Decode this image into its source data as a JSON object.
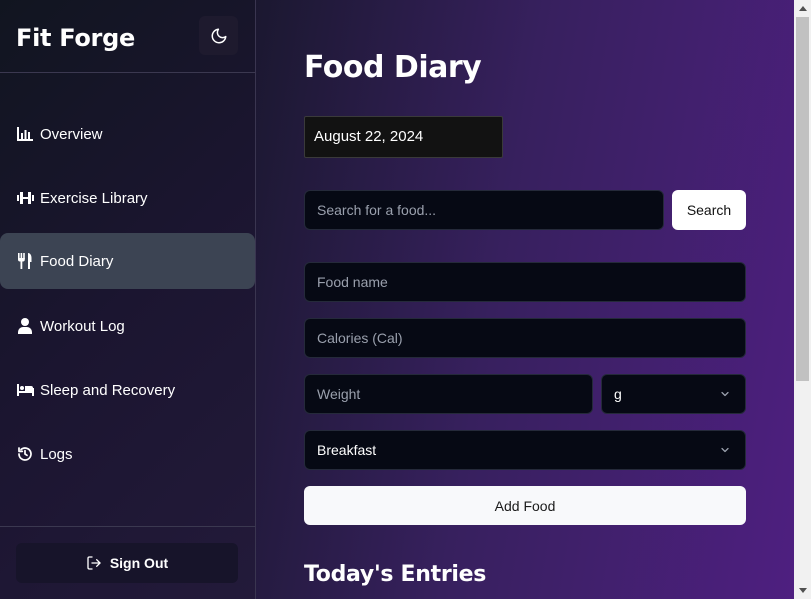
{
  "app": {
    "name": "Fit Forge"
  },
  "sidebar": {
    "theme_icon": "moon-icon",
    "items": [
      {
        "label": "Overview",
        "icon": "chart-bar-icon",
        "active": false
      },
      {
        "label": "Exercise Library",
        "icon": "dumbbell-icon",
        "active": false
      },
      {
        "label": "Food Diary",
        "icon": "utensils-icon",
        "active": true
      },
      {
        "label": "Workout Log",
        "icon": "user-icon",
        "active": false
      },
      {
        "label": "Sleep and Recovery",
        "icon": "bed-icon",
        "active": false
      },
      {
        "label": "Logs",
        "icon": "history-icon",
        "active": false
      }
    ],
    "sign_out": {
      "label": "Sign Out",
      "icon": "sign-out-icon"
    }
  },
  "main": {
    "title": "Food Diary",
    "date_value": "August 22, 2024",
    "search": {
      "placeholder": "Search for a food...",
      "button_label": "Search"
    },
    "form": {
      "food_name_placeholder": "Food name",
      "calories_placeholder": "Calories (Cal)",
      "weight_placeholder": "Weight",
      "unit_value": "g",
      "meal_value": "Breakfast",
      "add_button_label": "Add Food"
    },
    "entries_title": "Today's Entries"
  },
  "colors": {
    "accent_purple": "#4e1f80",
    "sidebar_active": "#3c4453",
    "input_bg": "#060914"
  }
}
